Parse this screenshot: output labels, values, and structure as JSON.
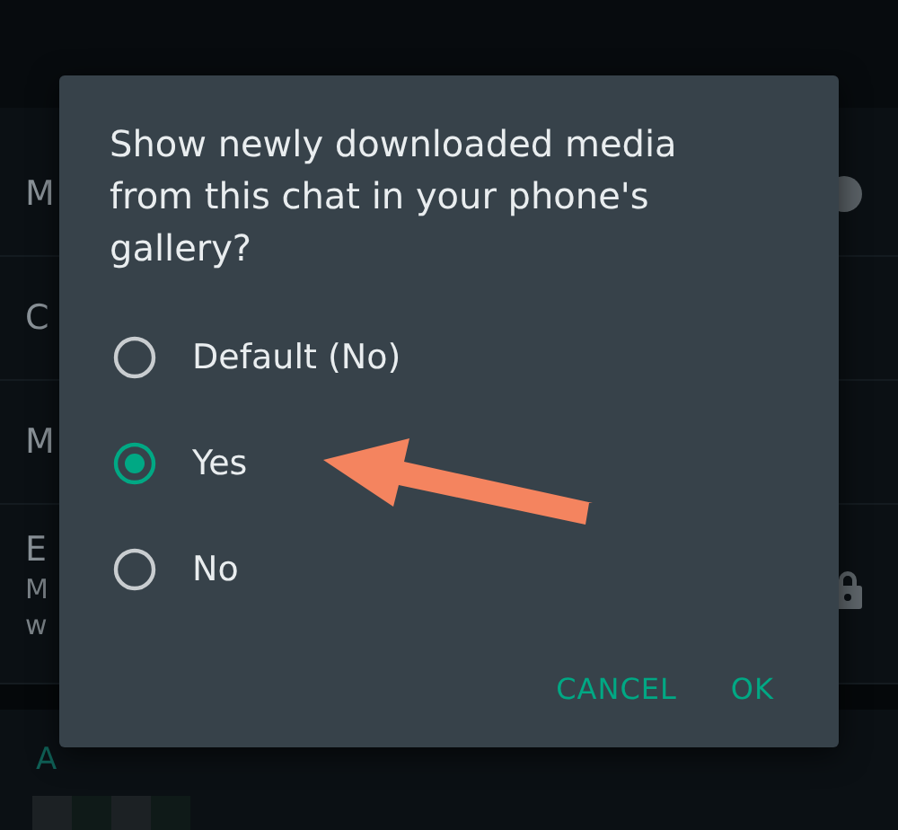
{
  "background": {
    "rows": [
      {
        "text": "M",
        "kind": "toggle"
      },
      {
        "text": "C",
        "kind": "plain"
      },
      {
        "text": "M",
        "kind": "plain"
      },
      {
        "text": "E",
        "kind": "lock",
        "subtext": [
          "M",
          "w"
        ]
      }
    ],
    "section_heading": "A"
  },
  "dialog": {
    "title": "Show newly downloaded media from this chat in your phone's gallery?",
    "options": [
      {
        "label": "Default (No)",
        "selected": false
      },
      {
        "label": "Yes",
        "selected": true
      },
      {
        "label": "No",
        "selected": false
      }
    ],
    "buttons": [
      "CANCEL",
      "OK"
    ]
  }
}
